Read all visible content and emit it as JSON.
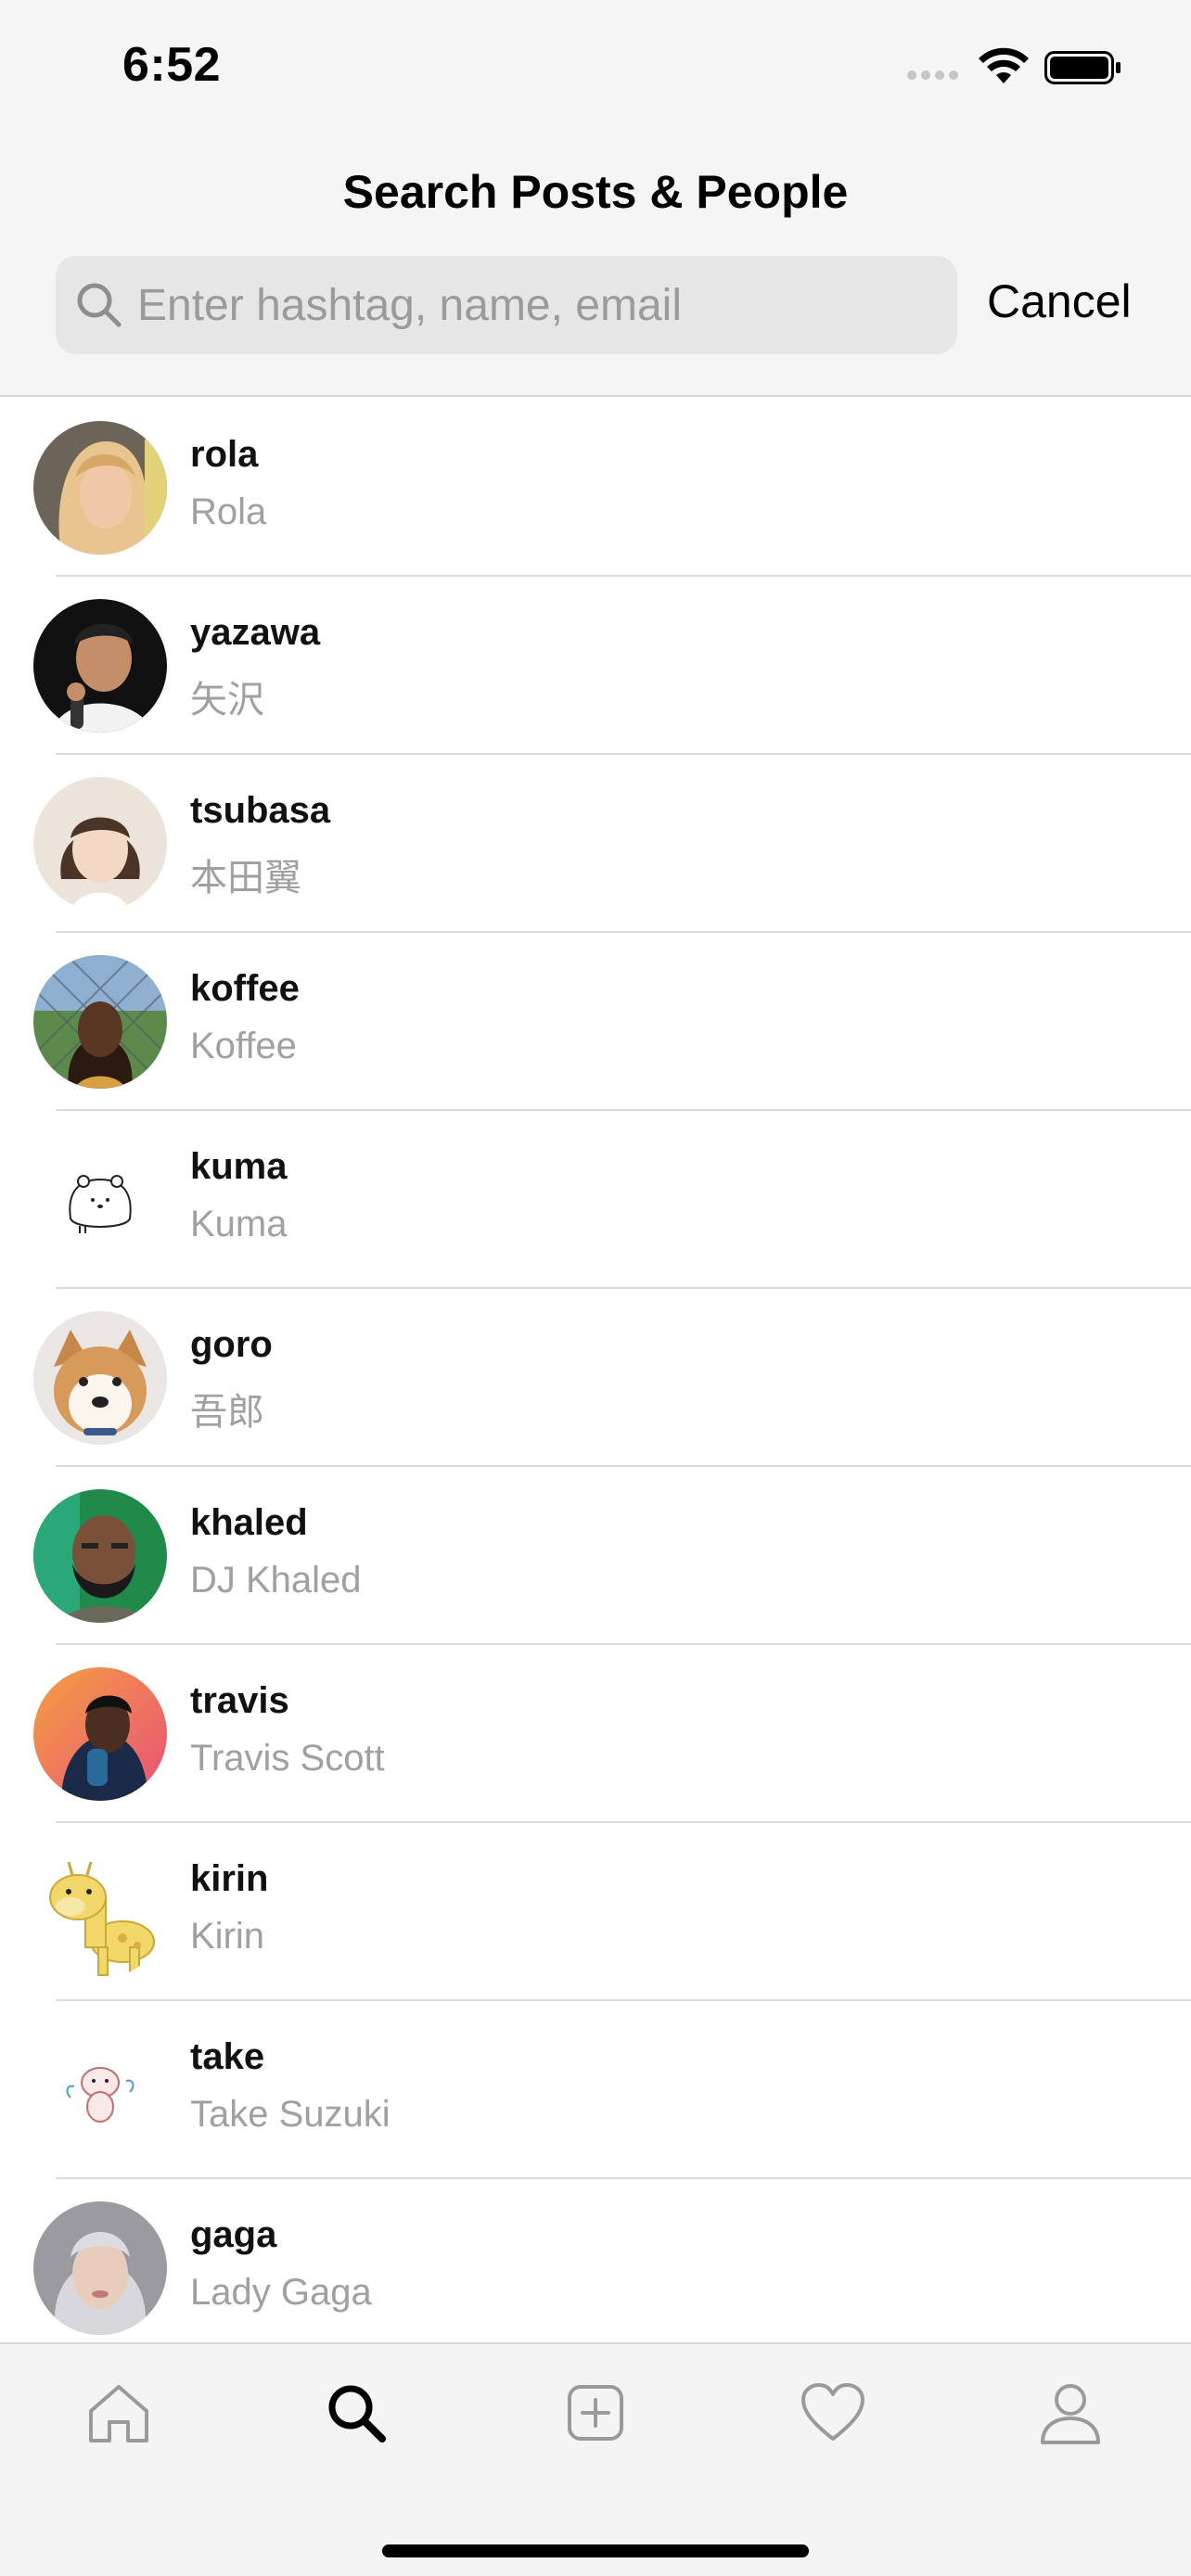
{
  "status_bar": {
    "time": "6:52"
  },
  "header": {
    "title": "Search Posts & People",
    "cancel_label": "Cancel"
  },
  "search": {
    "placeholder": "Enter hashtag, name, email",
    "value": ""
  },
  "users": [
    {
      "username": "rola",
      "name": "Rola",
      "avatar_colors": [
        "#d9b48a",
        "#8a6a4a"
      ]
    },
    {
      "username": "yazawa",
      "name": "矢沢",
      "avatar_colors": [
        "#1a1a1a",
        "#c98f6a"
      ]
    },
    {
      "username": "tsubasa",
      "name": "本田翼",
      "avatar_colors": [
        "#e8dcd0",
        "#4a3428"
      ]
    },
    {
      "username": "koffee",
      "name": "Koffee",
      "avatar_colors": [
        "#5b8a4a",
        "#3a2418"
      ]
    },
    {
      "username": "kuma",
      "name": "Kuma",
      "avatar_colors": [
        "#ffffff",
        "#222222"
      ]
    },
    {
      "username": "goro",
      "name": "吾郎",
      "avatar_colors": [
        "#e9e6e3",
        "#c8874a"
      ]
    },
    {
      "username": "khaled",
      "name": "DJ Khaled",
      "avatar_colors": [
        "#1f8a4a",
        "#6a4630"
      ]
    },
    {
      "username": "travis",
      "name": "Travis Scott",
      "avatar_colors": [
        "#e8627a",
        "#1c2a4a"
      ]
    },
    {
      "username": "kirin",
      "name": "Kirin",
      "avatar_colors": [
        "#ffffff",
        "#f2d86a"
      ]
    },
    {
      "username": "take",
      "name": "Take Suzuki",
      "avatar_colors": [
        "#ffffff",
        "#e8a8a8"
      ]
    },
    {
      "username": "gaga",
      "name": "Lady Gaga",
      "avatar_colors": [
        "#b8b8bc",
        "#e0c8b8"
      ]
    }
  ],
  "tab_bar": {
    "tabs": [
      {
        "icon": "home-icon",
        "active": false
      },
      {
        "icon": "search-icon",
        "active": true
      },
      {
        "icon": "add-post-icon",
        "active": false
      },
      {
        "icon": "heart-icon",
        "active": false
      },
      {
        "icon": "profile-icon",
        "active": false
      }
    ]
  }
}
